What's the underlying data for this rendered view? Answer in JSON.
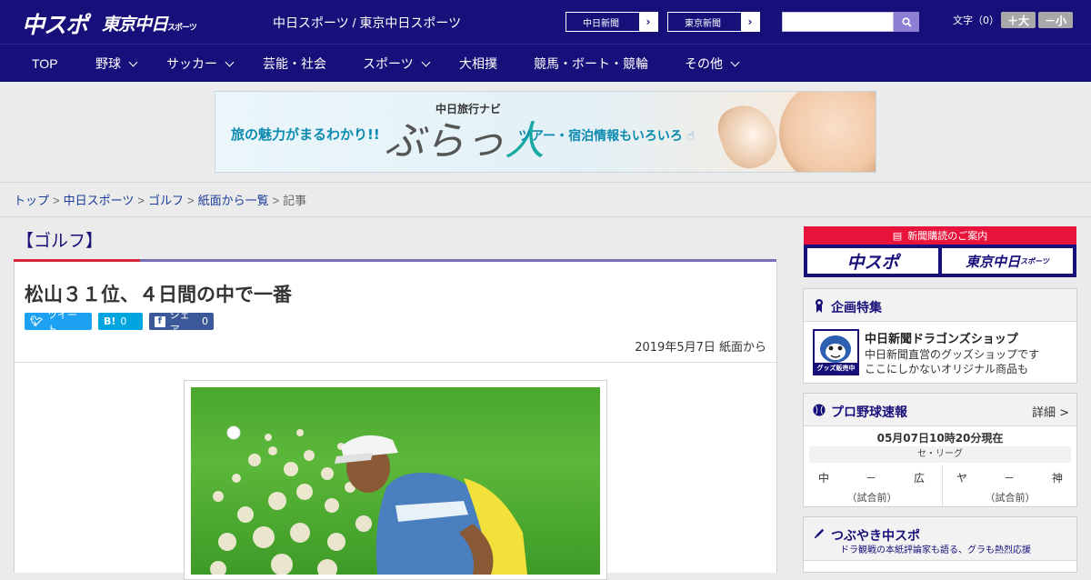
{
  "header": {
    "logo_chuspo": "中スポ",
    "logo_tokyo": "東京中日",
    "logo_tokyo_small": "スポーツ",
    "site_title": "中日スポーツ / 東京中日スポーツ",
    "ext_links": [
      {
        "label": "中日新聞"
      },
      {
        "label": "東京新聞"
      }
    ],
    "search_placeholder": "",
    "font_size": {
      "label": "文字（0）",
      "plus": "＋大",
      "minus": "－小"
    }
  },
  "nav": {
    "items": [
      {
        "label": "TOP",
        "has_menu": false
      },
      {
        "label": "野球",
        "has_menu": true
      },
      {
        "label": "サッカー",
        "has_menu": true
      },
      {
        "label": "芸能・社会",
        "has_menu": false
      },
      {
        "label": "スポーツ",
        "has_menu": true
      },
      {
        "label": "大相撲",
        "has_menu": false
      },
      {
        "label": "競馬・ボート・競輪",
        "has_menu": false
      },
      {
        "label": "その他",
        "has_menu": true
      }
    ]
  },
  "banner": {
    "left_text": "旅の魅力がまるわかり!!",
    "navi_text": "中日旅行ナビ",
    "big_text_a": "ぶらっ",
    "big_text_b": "人",
    "right_text": "ツアー・宿泊情報もいろいろ"
  },
  "breadcrumb": {
    "items": [
      "トップ",
      "中日スポーツ",
      "ゴルフ",
      "紙面から一覧"
    ],
    "current": "記事"
  },
  "article": {
    "category": "【ゴルフ】",
    "title": "松山３１位、４日間の中で一番",
    "share": {
      "tweet_label": "ツイート",
      "hatena_icon": "B!",
      "hatena_count": "0",
      "facebook_label": "シェア",
      "facebook_count": "0"
    },
    "date": "2019年5月7日 紙面から"
  },
  "sidebar": {
    "subscribe": {
      "heading": "新聞購読のご案内",
      "btn_chuspo": "中スポ",
      "btn_tokyo": "東京中日",
      "btn_tokyo_small": "スポーツ"
    },
    "feature": {
      "heading": "企画特集",
      "shop_badge": "グッズ販売中",
      "shop_title": "中日新聞ドラゴンズショップ",
      "shop_desc_1": "中日新聞直営のグッズショップです",
      "shop_desc_2": "ここにしかないオリジナル商品も"
    },
    "baseball": {
      "heading": "プロ野球速報",
      "more": "詳細 >",
      "time": "05月07日10時20分現在",
      "league": "セ・リーグ",
      "games": [
        {
          "team_a": "中",
          "dash": "－",
          "team_b": "広",
          "status": "（試合前）"
        },
        {
          "team_a": "ヤ",
          "dash": "－",
          "team_b": "神",
          "status": "（試合前）"
        }
      ]
    },
    "tweets": {
      "heading": "つぶやき中スポ",
      "sub": "ドラ観戦の本紙評論家も語る、グラも熱烈応援"
    }
  },
  "colors": {
    "header_navy": "#17107a",
    "accent_red": "#d9273a",
    "accent_purple": "#7b70b8",
    "subscribe_red": "#e8143b",
    "twitter_blue": "#1da1f2",
    "hatena_blue": "#00a4de",
    "facebook_blue": "#3b5998"
  }
}
